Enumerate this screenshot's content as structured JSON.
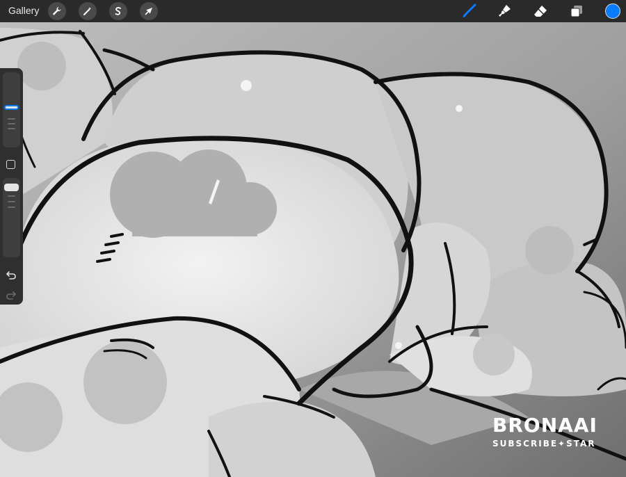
{
  "toolbar": {
    "gallery_label": "Gallery",
    "left_tools": [
      {
        "name": "wrench-icon"
      },
      {
        "name": "magic-wand-icon"
      },
      {
        "name": "selection-s-icon"
      },
      {
        "name": "move-arrow-icon"
      }
    ],
    "right_tools": [
      {
        "name": "brush-icon",
        "active": true
      },
      {
        "name": "smudge-icon"
      },
      {
        "name": "eraser-icon"
      },
      {
        "name": "layers-icon"
      }
    ],
    "current_color": "#0a7cff"
  },
  "sidebar": {
    "brush_size_icon": "size-slider",
    "opacity_icon": "opacity-slider",
    "undo_icon": "undo-arrow-icon",
    "redo_icon": "redo-arrow-icon"
  },
  "watermark": {
    "title": "BRONAAI",
    "subtitle": "SUBSCRIBE✦STAR"
  },
  "colors": {
    "toolbar_bg": "#2a2a2a",
    "accent": "#0a7cff",
    "sidebar_bg": "#2f2f2f"
  }
}
